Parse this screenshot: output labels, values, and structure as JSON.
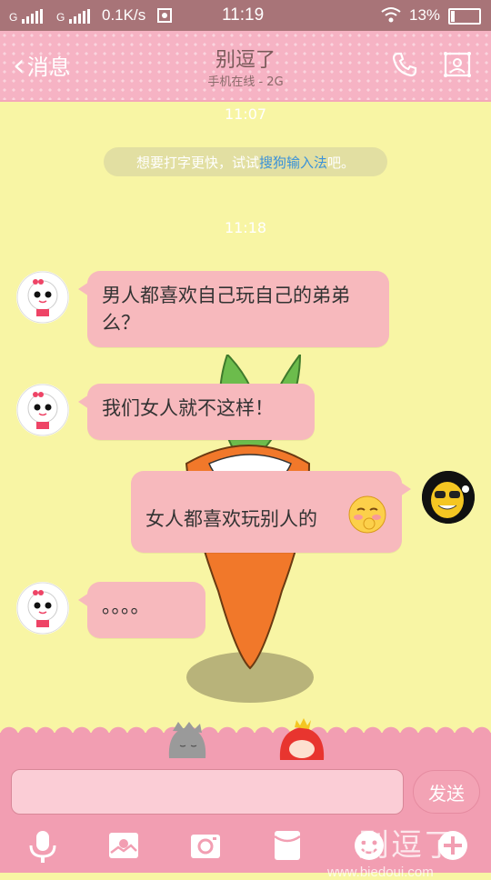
{
  "status_bar": {
    "sim1": "G",
    "sim2": "G",
    "speed": "0.1K/s",
    "time": "11:19",
    "battery_pct": "13%",
    "battery_level": 0.13
  },
  "header": {
    "back_label": "消息",
    "title": "别逗了",
    "subtitle": "手机在线 - 2G"
  },
  "chat": {
    "timestamp1": "11:07",
    "tip": {
      "prefix": "想要打字更快，试试",
      "link": "搜狗输入法",
      "suffix": "吧。"
    },
    "timestamp2": "11:18",
    "messages": [
      {
        "side": "left",
        "text": "男人都喜欢自己玩自己的弟弟么？"
      },
      {
        "side": "left",
        "text": "我们女人就不这样！"
      },
      {
        "side": "right",
        "text": "女人都喜欢玩别人的",
        "emoji": "blushing-emoji"
      },
      {
        "side": "left",
        "text": "。。。。"
      }
    ]
  },
  "composer": {
    "send_label": "发送",
    "input_value": ""
  },
  "toolbar": {
    "icons": [
      "microphone-icon",
      "image-icon",
      "camera-icon",
      "red-envelope-icon",
      "emoji-icon",
      "plus-icon"
    ]
  },
  "watermark": {
    "text_large": "别逗了",
    "text_small": "www.biedoui.com"
  },
  "colors": {
    "status_bar": "#a87478",
    "header": "#f6b3c4",
    "chat_bg": "#f8f5a4",
    "bubble": "#f7b9bd",
    "bottom_bar": "#f29eb2",
    "link": "#3b92d8"
  }
}
